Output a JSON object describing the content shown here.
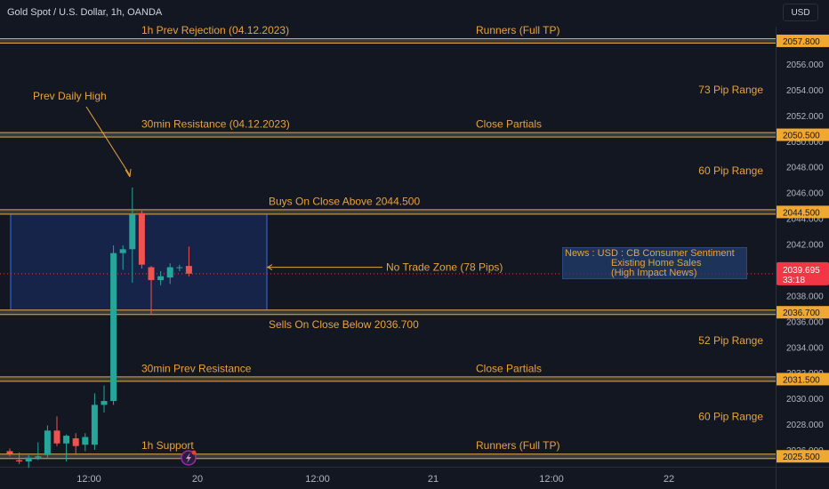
{
  "header": {
    "symbol": "Gold Spot / U.S. Dollar, 1h, OANDA",
    "currency": "USD"
  },
  "chart_data": {
    "type": "candlestick",
    "price_range": [
      2025.5,
      2058.3
    ],
    "y_ticks": [
      "2056.000",
      "2054.000",
      "2052.000",
      "2050.000",
      "2048.000",
      "2046.000",
      "2044.000",
      "2042.000",
      "2040.000",
      "2038.000",
      "2036.000",
      "2034.000",
      "2032.000",
      "2030.000",
      "2028.000",
      "2026.000"
    ],
    "x_ticks": [
      "12:00",
      "20",
      "12:00",
      "21",
      "12:00",
      "22"
    ],
    "colors": {
      "up": "#26a69a",
      "down": "#ef5350",
      "level": "#d9a84e",
      "text": "#e8a33d",
      "zone": "#2962ff",
      "price": "#f23645"
    },
    "candles": [
      {
        "o": 2025.9,
        "h": 2026.1,
        "l": 2025.5,
        "c": 2025.7
      },
      {
        "o": 2025.2,
        "h": 2025.8,
        "l": 2024.9,
        "c": 2025.1
      },
      {
        "o": 2025.1,
        "h": 2025.6,
        "l": 2024.6,
        "c": 2025.4
      },
      {
        "o": 2025.4,
        "h": 2026.6,
        "l": 2025.2,
        "c": 2025.5
      },
      {
        "o": 2025.6,
        "h": 2027.9,
        "l": 2025.3,
        "c": 2027.5
      },
      {
        "o": 2027.5,
        "h": 2028.6,
        "l": 2026.3,
        "c": 2026.5
      },
      {
        "o": 2026.5,
        "h": 2027.2,
        "l": 2025.1,
        "c": 2027.1
      },
      {
        "o": 2026.9,
        "h": 2027.3,
        "l": 2025.6,
        "c": 2026.3
      },
      {
        "o": 2026.4,
        "h": 2027.3,
        "l": 2025.9,
        "c": 2027.0
      },
      {
        "o": 2026.4,
        "h": 2030.4,
        "l": 2026.0,
        "c": 2029.5
      },
      {
        "o": 2029.5,
        "h": 2031.0,
        "l": 2028.9,
        "c": 2029.8
      },
      {
        "o": 2029.8,
        "h": 2041.9,
        "l": 2029.5,
        "c": 2041.3
      },
      {
        "o": 2041.3,
        "h": 2041.9,
        "l": 2040.0,
        "c": 2041.6
      },
      {
        "o": 2041.6,
        "h": 2046.4,
        "l": 2039.0,
        "c": 2044.3
      },
      {
        "o": 2044.4,
        "h": 2044.6,
        "l": 2040.1,
        "c": 2040.4
      },
      {
        "o": 2040.2,
        "h": 2040.3,
        "l": 2036.5,
        "c": 2039.2
      },
      {
        "o": 2039.2,
        "h": 2039.9,
        "l": 2038.8,
        "c": 2039.5
      },
      {
        "o": 2039.4,
        "h": 2040.5,
        "l": 2038.9,
        "c": 2040.2
      },
      {
        "o": 2040.2,
        "h": 2040.4,
        "l": 2039.9,
        "c": 2040.2
      },
      {
        "o": 2040.3,
        "h": 2041.8,
        "l": 2039.5,
        "c": 2039.7
      }
    ],
    "levels": [
      {
        "price": 2057.8,
        "label": "2057.800",
        "text_left": "1h Prev Rejection (04.12.2023)",
        "text_right": "Runners (Full TP)"
      },
      {
        "price": 2050.5,
        "label": "2050.500",
        "text_left": "30min Resistance (04.12.2023)",
        "text_right": "Close Partials"
      },
      {
        "price": 2044.5,
        "label": "2044.500",
        "text_mid": "Buys On Close Above 2044.500"
      },
      {
        "price": 2036.7,
        "label": "2036.700",
        "text_mid": "Sells On Close Below 2036.700"
      },
      {
        "price": 2031.5,
        "label": "2031.500",
        "text_left": "30min Prev Resistance",
        "text_right": "Close Partials"
      },
      {
        "price": 2025.5,
        "label": "2025.500",
        "text_left": "1h Support",
        "text_right": "Runners (Full TP)"
      }
    ],
    "ranges": [
      {
        "price": 2054.0,
        "text": "73 Pip Range"
      },
      {
        "price": 2047.7,
        "text": "60 Pip Range"
      },
      {
        "price": 2034.5,
        "text": "52 Pip Range"
      },
      {
        "price": 2028.6,
        "text": "60 Pip Range"
      }
    ],
    "annotations": {
      "prev_daily_high": "Prev Daily High",
      "no_trade_zone": "No Trade Zone (78 Pips)",
      "news": "News : USD : CB Consumer Sentiment\n                 Existing Home Sales\n                 (High Impact News)"
    },
    "current_price": {
      "value": "2039.695",
      "countdown": "33:18"
    }
  }
}
